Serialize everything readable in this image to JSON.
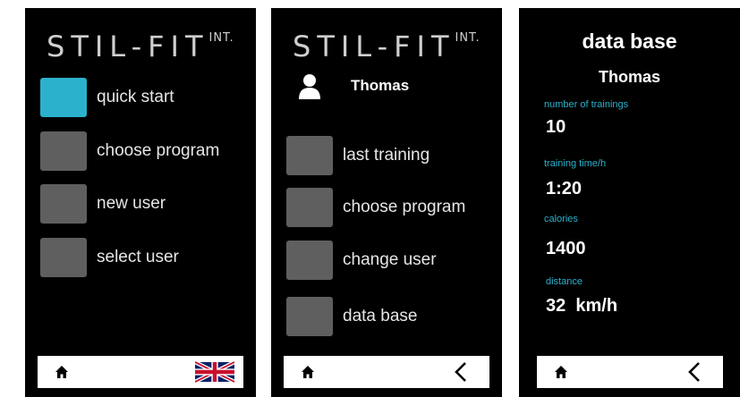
{
  "screen1": {
    "logo": "STIL-FIT",
    "logo_sup": "INT.",
    "menu": [
      {
        "label": "quick start",
        "highlight": true
      },
      {
        "label": "choose program"
      },
      {
        "label": "new user"
      },
      {
        "label": "select user"
      }
    ],
    "bottom": {
      "home_icon": "home-icon",
      "flag_icon": "uk-flag-icon"
    }
  },
  "screen2": {
    "logo": "STIL-FIT",
    "logo_sup": "INT.",
    "user_icon": "user-icon",
    "user_name": "Thomas",
    "menu": [
      {
        "label": "last training"
      },
      {
        "label": "choose program"
      },
      {
        "label": "change user"
      },
      {
        "label": "data base"
      }
    ],
    "bottom": {
      "home_icon": "home-icon",
      "back_icon": "chevron-left-icon"
    }
  },
  "screen3": {
    "title": "data base",
    "user_name": "Thomas",
    "stats": [
      {
        "label": "number of trainings",
        "value": "10"
      },
      {
        "label": "training time/h",
        "value": "1:20"
      },
      {
        "label": "calories",
        "value": "1400"
      },
      {
        "label": "distance",
        "value": "32  km/h"
      }
    ],
    "bottom": {
      "home_icon": "home-icon",
      "back_icon": "chevron-left-icon"
    }
  },
  "colors": {
    "accent": "#2bb1cc",
    "button_gray": "#5f5f5f",
    "background": "#000000"
  }
}
